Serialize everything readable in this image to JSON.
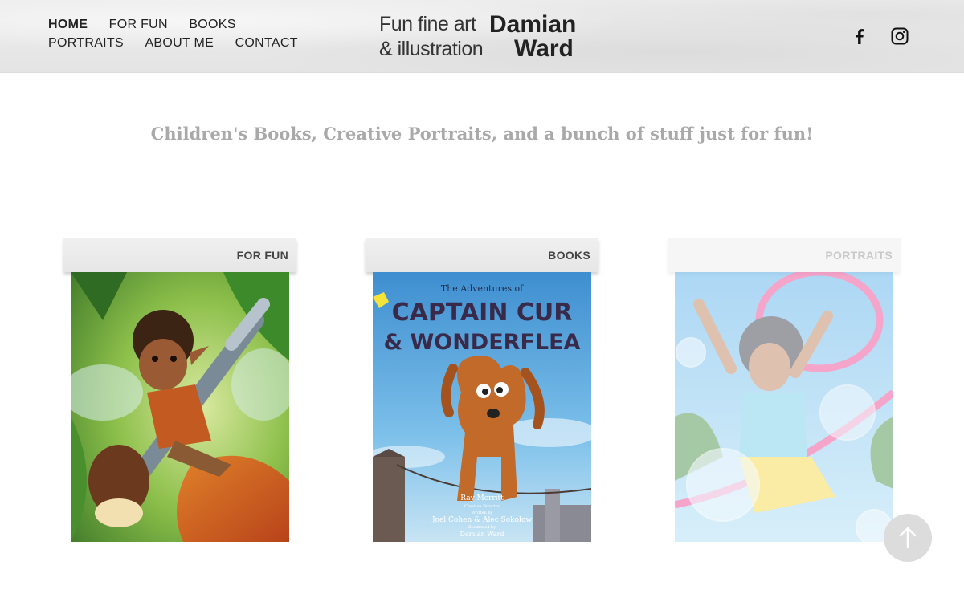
{
  "nav": {
    "items": [
      {
        "label": "HOME",
        "active": true
      },
      {
        "label": "FOR FUN",
        "active": false
      },
      {
        "label": "BOOKS",
        "active": false
      },
      {
        "label": "PORTRAITS",
        "active": false
      },
      {
        "label": "ABOUT ME",
        "active": false
      },
      {
        "label": "CONTACT",
        "active": false
      }
    ]
  },
  "logo": {
    "line1_left": "Fun fine art",
    "line2_left": "& illustration",
    "line1_right": "Damian",
    "line2_right": "Ward"
  },
  "social": {
    "icons": [
      "facebook-icon",
      "instagram-icon"
    ]
  },
  "tagline": "Children's Books, Creative Portraits, and a bunch of stuff just for fun!",
  "cards": [
    {
      "label": "FOR FUN",
      "image": "fairy-boy-riding-paintbrush"
    },
    {
      "label": "BOOKS",
      "image": "book-cover-captain-cur",
      "cover": {
        "subtitle": "The Adventures of",
        "title_line1": "CAPTAIN CUR",
        "title_line2": "& WONDERFLEA",
        "credit_name": "Ray Merritt",
        "credit_role": "Creative Director",
        "written_by": "Written by",
        "authors": "Joel Cohen & Alec Sokolow",
        "illustrated_by": "Illustrated by",
        "illustrator": "Damian Ward"
      }
    },
    {
      "label": "PORTRAITS",
      "image": "girl-with-bubbles-portrait"
    }
  ],
  "back_to_top": {
    "icon": "arrow-up-icon"
  },
  "colors": {
    "tagline": "#a9a9a9",
    "book_sky": "#4a9fd8",
    "book_title": "#3a2a4a"
  }
}
